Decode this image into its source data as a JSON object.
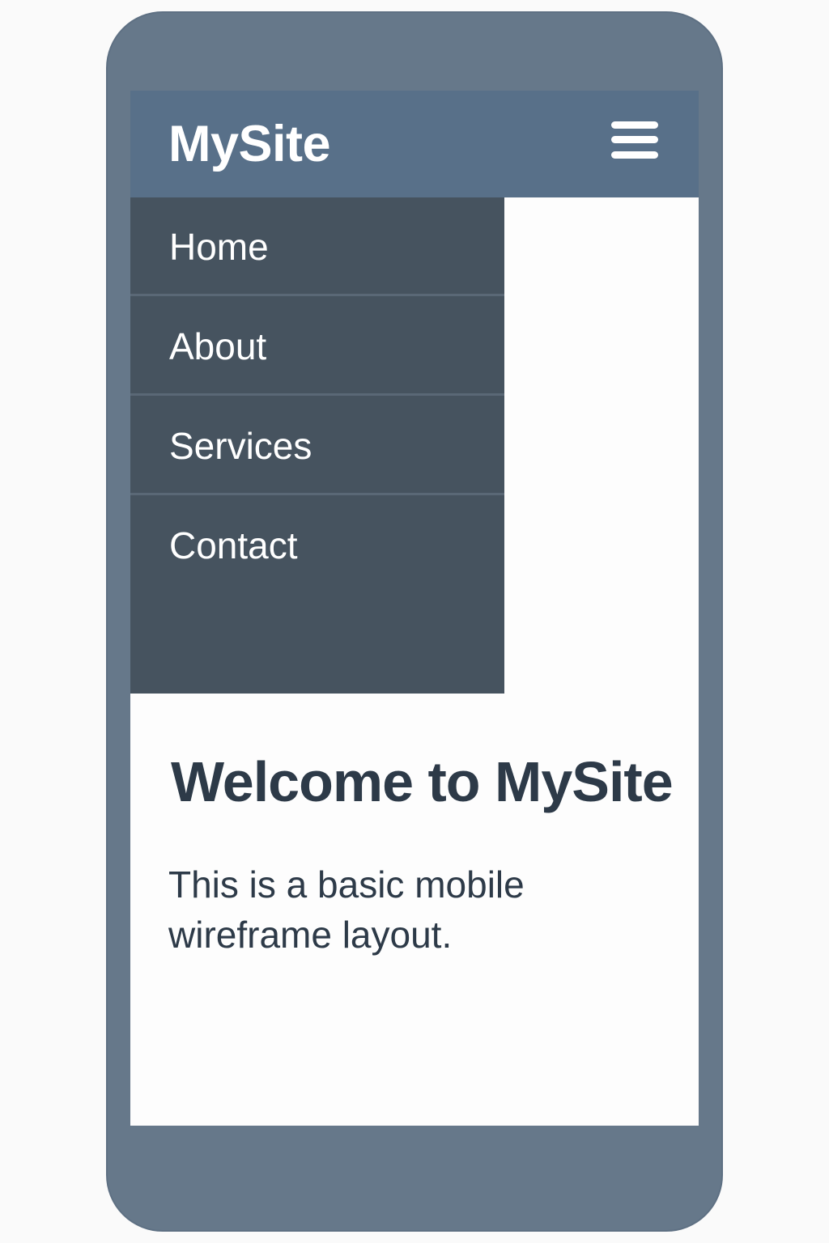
{
  "header": {
    "logo": "MySite",
    "menu_icon": "hamburger-menu-icon"
  },
  "nav": {
    "items": [
      {
        "label": "Home"
      },
      {
        "label": "About"
      },
      {
        "label": "Services"
      },
      {
        "label": "Contact"
      }
    ]
  },
  "main": {
    "heading": "Welcome to MySite",
    "body": "This is a basic mobile wireframe layout."
  },
  "colors": {
    "phone_frame": "#66788a",
    "header_bg": "#587089",
    "drawer_bg": "#46535f",
    "text_dark": "#2d3a48"
  }
}
